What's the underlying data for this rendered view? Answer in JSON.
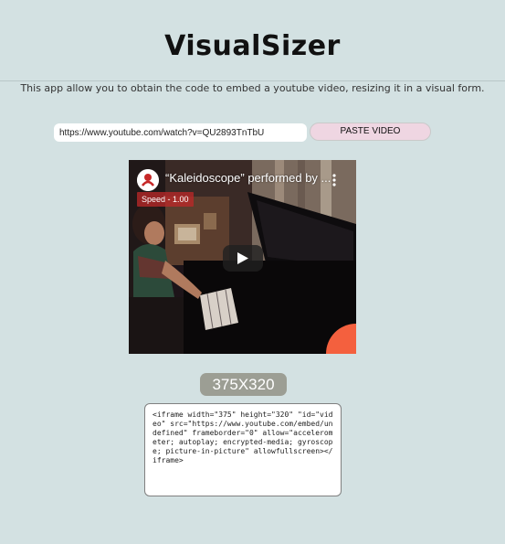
{
  "app": {
    "title": "VisualSizer",
    "subtitle": "This app allow you to obtain the code to embed a youtube video, resizing it in a visual form."
  },
  "form": {
    "url_value": "https://www.youtube.com/watch?v=QU2893TnTbU",
    "paste_button_label": "PASTE VIDEO"
  },
  "video": {
    "title": "“Kaleidoscope” performed by ...",
    "speed_label": "Speed - 1.00",
    "channel_logo_icon": "channel-logo-icon",
    "play_icon": "play-icon",
    "more_icon": "more-vert-icon",
    "corner_badge_color": "#f4603e"
  },
  "size_label": "375X320",
  "embed_code": "<iframe width=\"375\" height=\"320\" \"id=\"video\" src=\"https://www.youtube.com/embed/undefined\" frameborder=\"0\" allow=\"accelerometer; autoplay; encrypted-media; gyroscope; picture-in-picture\" allowfullscreen></iframe>"
}
